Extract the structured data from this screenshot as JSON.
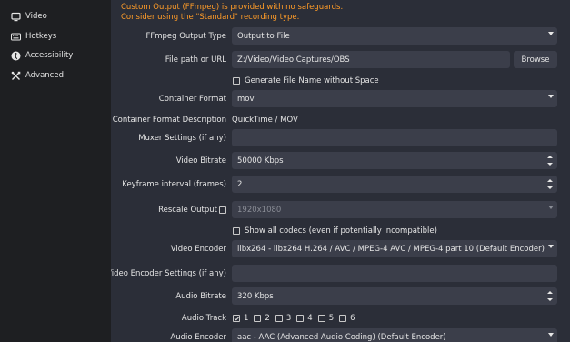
{
  "sidebar": {
    "items": [
      {
        "label": "Video",
        "icon": "monitor-icon"
      },
      {
        "label": "Hotkeys",
        "icon": "keyboard-icon"
      },
      {
        "label": "Accessibility",
        "icon": "accessibility-icon"
      },
      {
        "label": "Advanced",
        "icon": "wrench-screwdriver-icon"
      }
    ]
  },
  "warning": {
    "line1": "Custom Output (FFmpeg) is provided with no safeguards.",
    "line2": "Consider using the \"Standard\" recording type."
  },
  "form": {
    "ffmpeg_output_type": {
      "label": "FFmpeg Output Type",
      "value": "Output to File"
    },
    "file_path": {
      "label": "File path or URL",
      "value": "Z:/Video/Video Captures/OBS",
      "browse": "Browse"
    },
    "generate_name": {
      "label": "Generate File Name without Space",
      "checked": false
    },
    "container_format": {
      "label": "Container Format",
      "value": "mov"
    },
    "container_desc": {
      "label": "Container Format Description",
      "value": "QuickTime / MOV"
    },
    "muxer_settings": {
      "label": "Muxer Settings (if any)",
      "value": ""
    },
    "video_bitrate": {
      "label": "Video Bitrate",
      "value": "50000 Kbps"
    },
    "keyframe_interval": {
      "label": "Keyframe interval (frames)",
      "value": "2"
    },
    "rescale_output": {
      "label": "Rescale Output",
      "checked": false,
      "value": "1920x1080"
    },
    "show_all_codecs": {
      "label": "Show all codecs (even if potentially incompatible)",
      "checked": false
    },
    "video_encoder": {
      "label": "Video Encoder",
      "value": "libx264 - libx264 H.264 / AVC / MPEG-4 AVC / MPEG-4 part 10 (Default Encoder)"
    },
    "video_encoder_settings": {
      "label": "Video Encoder Settings (if any)",
      "value": ""
    },
    "audio_bitrate": {
      "label": "Audio Bitrate",
      "value": "320 Kbps"
    },
    "audio_track": {
      "label": "Audio Track",
      "tracks": [
        {
          "label": "1",
          "checked": true
        },
        {
          "label": "2",
          "checked": false
        },
        {
          "label": "3",
          "checked": false
        },
        {
          "label": "4",
          "checked": false
        },
        {
          "label": "5",
          "checked": false
        },
        {
          "label": "6",
          "checked": false
        }
      ]
    },
    "audio_encoder": {
      "label": "Audio Encoder",
      "value": "aac - AAC (Advanced Audio Coding) (Default Encoder)"
    }
  },
  "colors": {
    "warning": "#ff9c28",
    "panel": "#2b2e38",
    "field": "#3b3e4a",
    "sidebar": "#1e1f22"
  }
}
